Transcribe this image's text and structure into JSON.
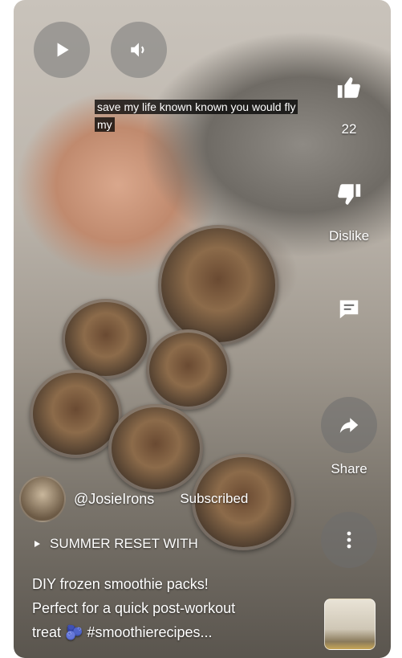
{
  "caption": {
    "line1": "save my life known known you would fly",
    "line2": "my"
  },
  "controls": {
    "play_icon": "play-icon",
    "volume_icon": "volume-icon"
  },
  "actions": {
    "like_count": "22",
    "dislike_label": "Dislike",
    "comment_icon": "comment-icon",
    "share_label": "Share",
    "more_icon": "more-vertical-icon"
  },
  "channel": {
    "handle": "@JosieIrons",
    "subscribe_state": "Subscribed"
  },
  "playlist": {
    "label": "SUMMER RESET WITH"
  },
  "description": {
    "line1": "DIY frozen smoothie packs!",
    "line2": "Perfect for a quick post-workout",
    "line3": "treat 🫐 #smoothierecipes..."
  }
}
